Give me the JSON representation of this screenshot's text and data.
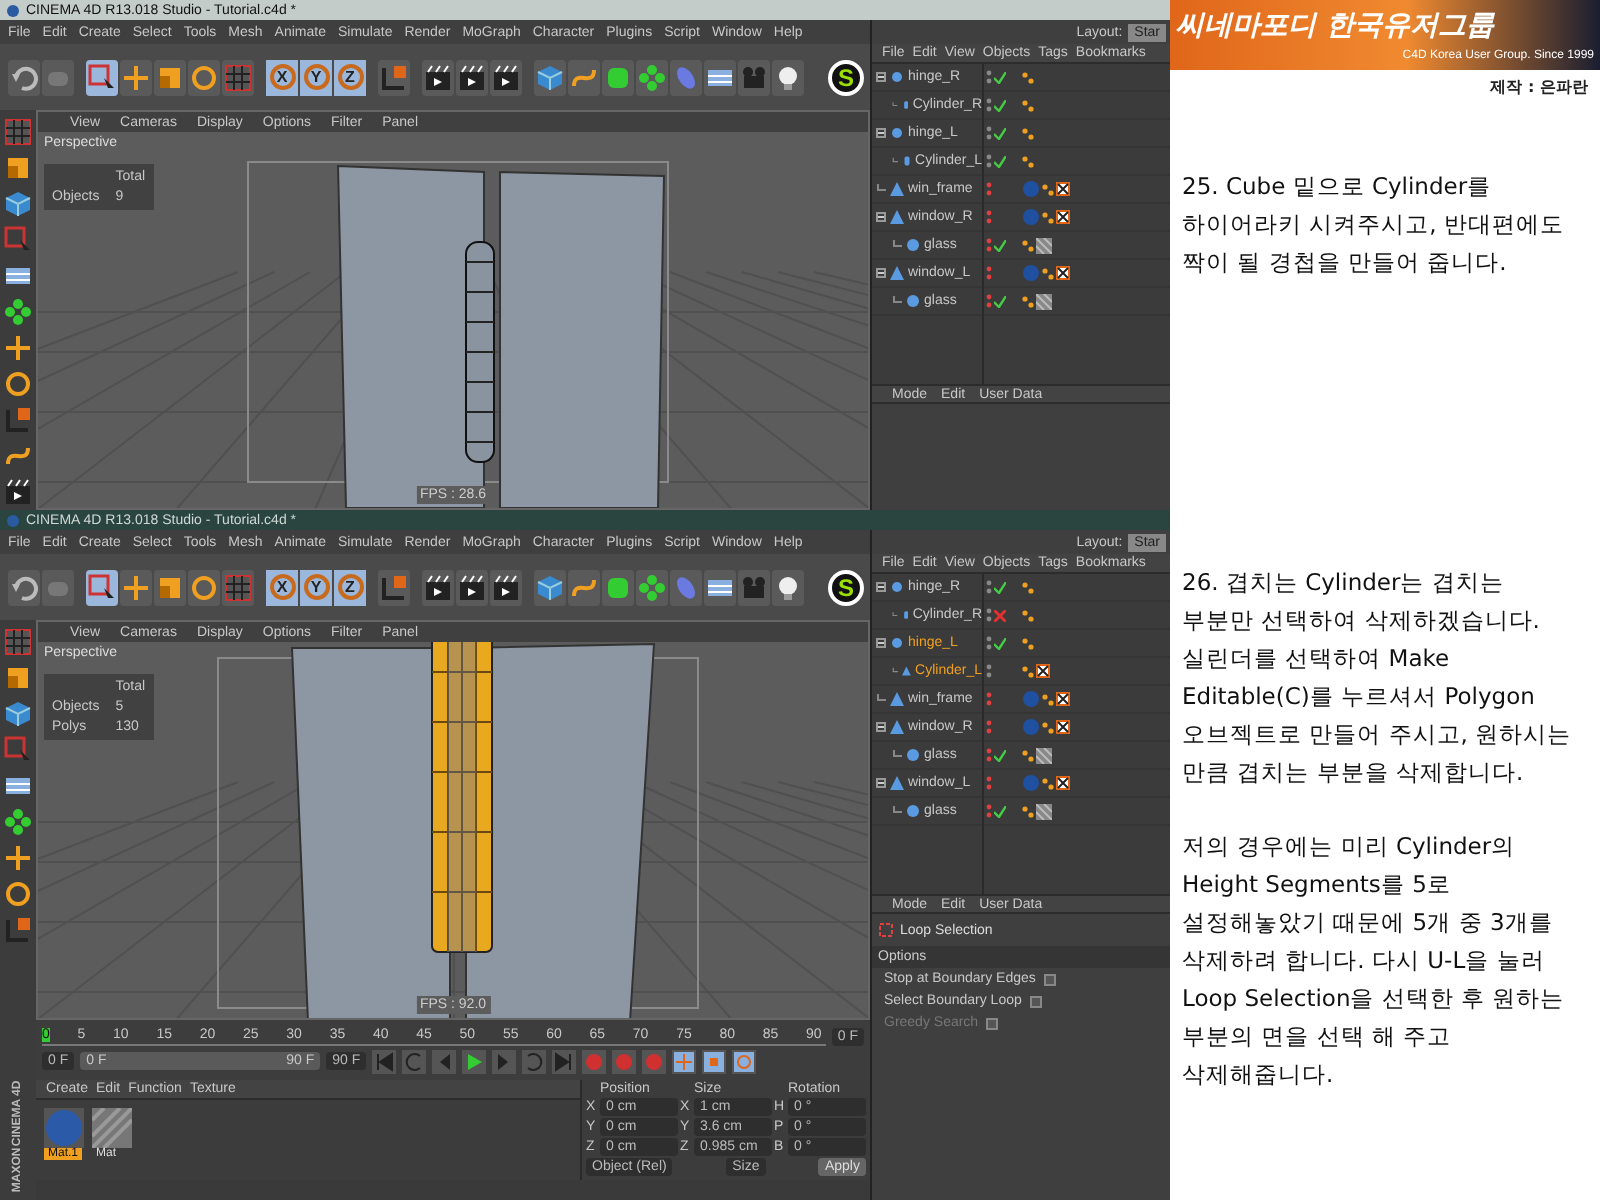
{
  "banner": {
    "logo": "씨네마포디 한국유저그룹",
    "tagline": "C4D Korea User Group. Since 1999"
  },
  "credit": "제작 : 은파란",
  "steps": [
    {
      "paragraphs": [
        [
          "25. Cube 밑으로 Cylinder를",
          "하이어라키 시켜주시고, 반대편에도",
          "짝이 될 경첩을 만들어 줍니다."
        ]
      ]
    },
    {
      "paragraphs": [
        [
          "26. 겹치는 Cylinder는 겹치는",
          "부분만 선택하여 삭제하겠습니다.",
          "실린더를 선택하여 Make",
          "Editable(C)를 누르셔서 Polygon",
          "오브젝트로 만들어 주시고, 원하시는",
          "만큼 겹치는 부분을 삭제합니다."
        ],
        [
          "저의 경우에는 미리 Cylinder의",
          "Height Segments를 5로",
          "설정해놓았기 때문에 5개 중 3개를",
          "삭제하려 합니다. 다시 U-L을 눌러",
          "Loop Selection을 선택한 후 원하는",
          "부분의 면을 선택 해 주고",
          "삭제해줍니다."
        ]
      ]
    }
  ],
  "screens": [
    {
      "title": "CINEMA 4D R13.018 Studio - Tutorial.c4d *",
      "menu": [
        "File",
        "Edit",
        "Create",
        "Select",
        "Tools",
        "Mesh",
        "Animate",
        "Simulate",
        "Render",
        "MoGraph",
        "Character",
        "Plugins",
        "Script",
        "Window",
        "Help"
      ],
      "axes": [
        "X",
        "Y",
        "Z"
      ],
      "badge": "S",
      "layout_label": "Layout:",
      "layout_value": "Star",
      "viewport": {
        "menu": [
          "View",
          "Cameras",
          "Display",
          "Options",
          "Filter",
          "Panel"
        ],
        "camera": "Perspective",
        "hud_title": "Total",
        "hud": [
          {
            "label": "Objects",
            "value": "9"
          }
        ],
        "fps": "FPS : 28.6",
        "hinge_selected": false
      },
      "objects": {
        "menu": [
          "File",
          "Edit",
          "View",
          "Objects",
          "Tags",
          "Bookmarks"
        ],
        "tree": [
          {
            "name": "hinge_R",
            "kind": "null",
            "selected": false,
            "enabled": true,
            "children": [
              {
                "name": "Cylinder_R",
                "kind": "cylinder",
                "selected": false,
                "enabled": true
              }
            ]
          },
          {
            "name": "hinge_L",
            "kind": "null",
            "selected": false,
            "enabled": true,
            "children": [
              {
                "name": "Cylinder_L",
                "kind": "cylinder",
                "selected": false,
                "enabled": true
              }
            ]
          },
          {
            "name": "win_frame",
            "kind": "extrude",
            "selected": false,
            "enabled": true
          },
          {
            "name": "window_R",
            "kind": "extrude",
            "selected": false,
            "enabled": true,
            "children": [
              {
                "name": "glass",
                "kind": "sphere",
                "selected": false,
                "enabled": true
              }
            ]
          },
          {
            "name": "window_L",
            "kind": "extrude",
            "selected": false,
            "enabled": true,
            "children": [
              {
                "name": "glass",
                "kind": "sphere",
                "selected": false,
                "enabled": true
              }
            ]
          }
        ]
      },
      "attributes": {
        "menu": [
          "Mode",
          "Edit",
          "User Data"
        ]
      }
    },
    {
      "title": "CINEMA 4D R13.018 Studio - Tutorial.c4d *",
      "menu": [
        "File",
        "Edit",
        "Create",
        "Select",
        "Tools",
        "Mesh",
        "Animate",
        "Simulate",
        "Render",
        "MoGraph",
        "Character",
        "Plugins",
        "Script",
        "Window",
        "Help"
      ],
      "axes": [
        "X",
        "Y",
        "Z"
      ],
      "badge": "S",
      "layout_label": "Layout:",
      "layout_value": "Star",
      "viewport": {
        "menu": [
          "View",
          "Cameras",
          "Display",
          "Options",
          "Filter",
          "Panel"
        ],
        "camera": "Perspective",
        "hud_title": "Total",
        "hud": [
          {
            "label": "Objects",
            "value": "5"
          },
          {
            "label": "Polys",
            "value": "130"
          }
        ],
        "fps": "FPS : 92.0",
        "hinge_selected": true
      },
      "objects": {
        "menu": [
          "File",
          "Edit",
          "View",
          "Objects",
          "Tags",
          "Bookmarks"
        ],
        "tree": [
          {
            "name": "hinge_R",
            "kind": "null",
            "selected": false,
            "enabled": true,
            "children": [
              {
                "name": "Cylinder_R",
                "kind": "cylinder",
                "selected": false,
                "enabled": false
              }
            ]
          },
          {
            "name": "hinge_L",
            "kind": "null",
            "selected": true,
            "enabled": true,
            "children": [
              {
                "name": "Cylinder_L",
                "kind": "polygon",
                "selected": true,
                "enabled": true
              }
            ]
          },
          {
            "name": "win_frame",
            "kind": "extrude",
            "selected": false,
            "enabled": true
          },
          {
            "name": "window_R",
            "kind": "extrude",
            "selected": false,
            "enabled": true,
            "children": [
              {
                "name": "glass",
                "kind": "sphere",
                "selected": false,
                "enabled": true
              }
            ]
          },
          {
            "name": "window_L",
            "kind": "extrude",
            "selected": false,
            "enabled": true,
            "children": [
              {
                "name": "glass",
                "kind": "sphere",
                "selected": false,
                "enabled": true
              }
            ]
          }
        ]
      },
      "attributes": {
        "menu": [
          "Mode",
          "Edit",
          "User Data"
        ],
        "tool": "Loop Selection",
        "section": "Options",
        "options": [
          {
            "label": "Stop at Boundary Edges",
            "checked": false,
            "disabled": false
          },
          {
            "label": "Select Boundary Loop",
            "checked": false,
            "disabled": false
          },
          {
            "label": "Greedy Search",
            "checked": false,
            "disabled": true
          }
        ]
      },
      "timeline": {
        "ticks": [
          "0",
          "5",
          "10",
          "15",
          "20",
          "25",
          "30",
          "35",
          "40",
          "45",
          "50",
          "55",
          "60",
          "65",
          "70",
          "75",
          "80",
          "85",
          "90"
        ],
        "current": "0 F",
        "start": "0 F",
        "range_start": "0 F",
        "range_end": "90 F",
        "end": "90 F"
      },
      "materials": {
        "menu": [
          "Create",
          "Edit",
          "Function",
          "Texture"
        ],
        "items": [
          {
            "name": "Mat.1",
            "selected": true,
            "kind": "sphere"
          },
          {
            "name": "Mat",
            "selected": false,
            "kind": "texture"
          }
        ]
      },
      "coordinates": {
        "headers": [
          "Position",
          "Size",
          "Rotation"
        ],
        "rows": [
          {
            "axis": "X",
            "position": "0 cm",
            "size_axis": "X",
            "size": "1 cm",
            "rot_axis": "H",
            "rotation": "0 °"
          },
          {
            "axis": "Y",
            "position": "0 cm",
            "size_axis": "Y",
            "size": "3.6 cm",
            "rot_axis": "P",
            "rotation": "0 °"
          },
          {
            "axis": "Z",
            "position": "0 cm",
            "size_axis": "Z",
            "size": "0.985 cm",
            "rot_axis": "B",
            "rotation": "0 °"
          }
        ],
        "mode": "Object (Rel)",
        "size_mode": "Size",
        "apply": "Apply"
      },
      "logo": [
        "MAXON",
        "CINEMA 4D"
      ]
    }
  ]
}
